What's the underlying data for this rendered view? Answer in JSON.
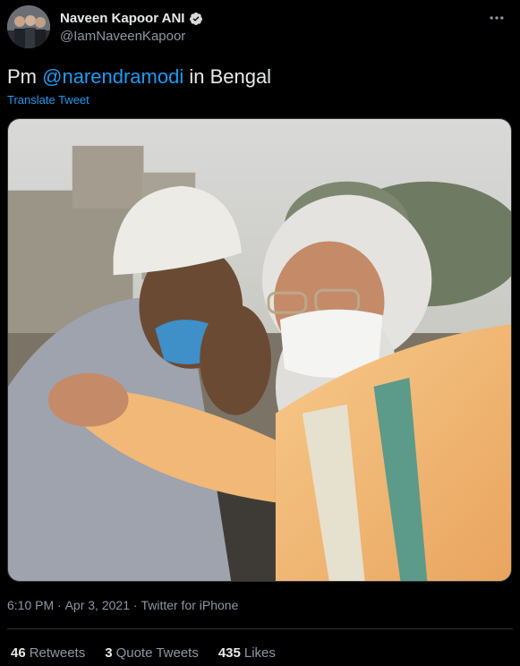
{
  "author": {
    "display_name": "Naveen Kapoor ANI",
    "handle": "@IamNaveenKapoor"
  },
  "tweet": {
    "text_prefix": "Pm ",
    "mention": "@narendramodi",
    "text_suffix": " in Bengal",
    "translate_label": "Translate Tweet"
  },
  "meta": {
    "time": "6:10 PM",
    "sep1": " · ",
    "date": "Apr 3, 2021",
    "sep2": " · ",
    "source": "Twitter for iPhone"
  },
  "stats": {
    "retweets_count": "46",
    "retweets_label": "Retweets",
    "quotes_count": "3",
    "quotes_label": "Quote Tweets",
    "likes_count": "435",
    "likes_label": "Likes"
  },
  "colors": {
    "accent": "#1d9bf0",
    "background": "#000000"
  },
  "icons": {
    "verified": "verified-badge-icon",
    "more": "more-options-icon"
  }
}
